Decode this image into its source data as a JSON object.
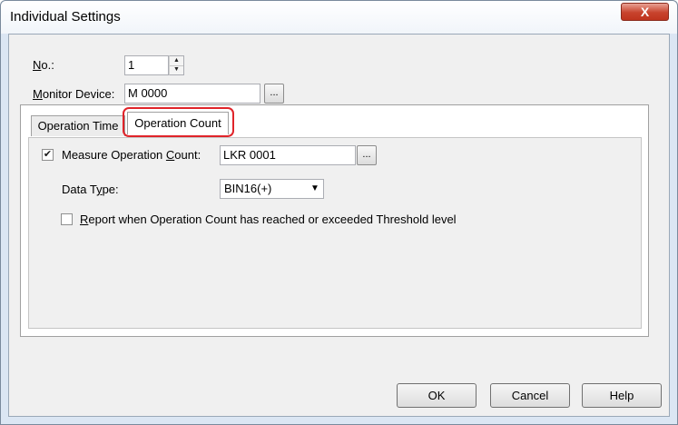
{
  "window": {
    "title": "Individual Settings",
    "close_label": "X"
  },
  "no": {
    "label_letter": "N",
    "label_rest": "o.:",
    "value": "1",
    "spin_up": "▲",
    "spin_down": "▼"
  },
  "monitor_device": {
    "label_letter": "M",
    "label_rest": "onitor Device:",
    "value": "M 0000",
    "browse_label": "..."
  },
  "tabs": [
    {
      "label": "Operation Time"
    },
    {
      "label": "Operation Count"
    }
  ],
  "measure": {
    "checked": true,
    "check_glyph": "✔",
    "label_before": "Measure Operation ",
    "label_letter": "C",
    "label_after": "ount:",
    "value": "LKR 0001",
    "browse_label": "..."
  },
  "data_type": {
    "label_before": "Data T",
    "label_letter": "y",
    "label_after": "pe:",
    "value": "BIN16(+)",
    "arrow": "▼"
  },
  "report": {
    "checked": false,
    "label_letter": "R",
    "label_rest": "eport when Operation Count has reached or exceeded Threshold level"
  },
  "buttons": {
    "ok": "OK",
    "cancel": "Cancel",
    "help": "Help"
  }
}
